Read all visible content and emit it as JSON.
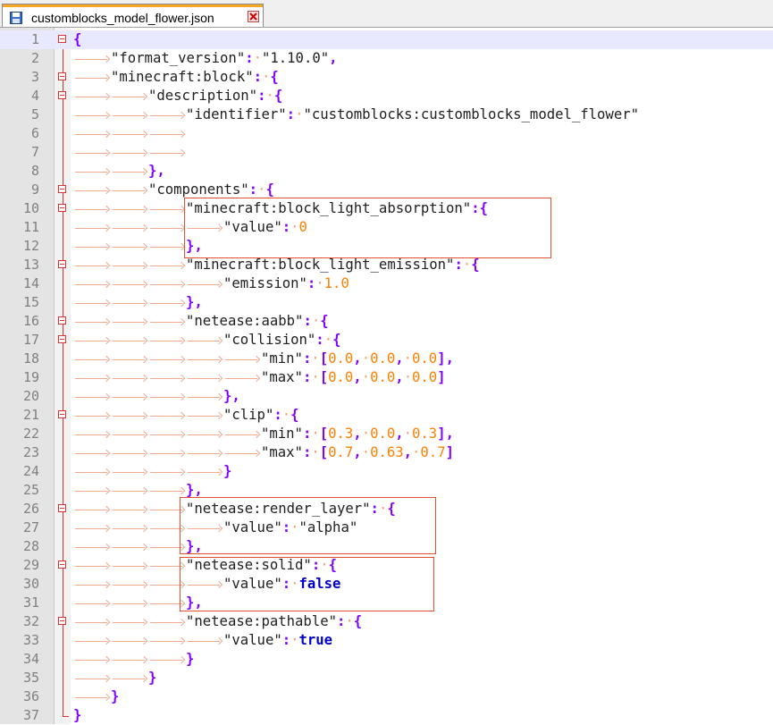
{
  "tab": {
    "title": "customblocks_model_flower.json",
    "save_icon": "floppy-disk-icon",
    "close_icon": "close-icon"
  },
  "colors": {
    "operator": "#8000ff",
    "number": "#ff8000",
    "keyword": "#0000cc",
    "fold_marker": "#e03030",
    "annotation_box": "#e05030"
  },
  "lines": [
    {
      "n": "1",
      "i": 0,
      "f": "open",
      "t": [
        [
          "op",
          "{"
        ]
      ]
    },
    {
      "n": "2",
      "i": 1,
      "f": "",
      "t": [
        [
          "str",
          "\"format_version\""
        ],
        [
          "op",
          ":"
        ],
        [
          "sp",
          "·"
        ],
        [
          "str",
          "\"1.10.0\""
        ],
        [
          "op",
          ","
        ]
      ]
    },
    {
      "n": "3",
      "i": 1,
      "f": "open",
      "t": [
        [
          "str",
          "\"minecraft:block\""
        ],
        [
          "op",
          ":"
        ],
        [
          "sp",
          "·"
        ],
        [
          "op",
          "{"
        ]
      ]
    },
    {
      "n": "4",
      "i": 2,
      "f": "open",
      "t": [
        [
          "str",
          "\"description\""
        ],
        [
          "op",
          ":"
        ],
        [
          "sp",
          "·"
        ],
        [
          "op",
          "{"
        ]
      ]
    },
    {
      "n": "5",
      "i": 3,
      "f": "",
      "t": [
        [
          "str",
          "\"identifier\""
        ],
        [
          "op",
          ":"
        ],
        [
          "sp",
          "·"
        ],
        [
          "str",
          "\"customblocks:customblocks_model_flower\""
        ]
      ]
    },
    {
      "n": "6",
      "i": 3,
      "f": "",
      "t": []
    },
    {
      "n": "7",
      "i": 3,
      "f": "",
      "t": []
    },
    {
      "n": "8",
      "i": 2,
      "f": "",
      "t": [
        [
          "op",
          "}"
        ],
        [
          "op",
          ","
        ]
      ]
    },
    {
      "n": "9",
      "i": 2,
      "f": "open",
      "t": [
        [
          "str",
          "\"components\""
        ],
        [
          "op",
          ":"
        ],
        [
          "sp",
          "·"
        ],
        [
          "op",
          "{"
        ]
      ]
    },
    {
      "n": "10",
      "i": 3,
      "f": "open",
      "t": [
        [
          "str",
          "\"minecraft:block_light_absorption\""
        ],
        [
          "op",
          ":"
        ],
        [
          "op",
          "{"
        ]
      ]
    },
    {
      "n": "11",
      "i": 4,
      "f": "",
      "t": [
        [
          "str",
          "\"value\""
        ],
        [
          "op",
          ":"
        ],
        [
          "sp",
          "·"
        ],
        [
          "num",
          "0"
        ]
      ]
    },
    {
      "n": "12",
      "i": 3,
      "f": "",
      "t": [
        [
          "op",
          "}"
        ],
        [
          "op",
          ","
        ]
      ]
    },
    {
      "n": "13",
      "i": 3,
      "f": "open",
      "t": [
        [
          "str",
          "\"minecraft:block_light_emission\""
        ],
        [
          "op",
          ":"
        ],
        [
          "sp",
          "·"
        ],
        [
          "op",
          "{"
        ]
      ]
    },
    {
      "n": "14",
      "i": 4,
      "f": "",
      "t": [
        [
          "str",
          "\"emission\""
        ],
        [
          "op",
          ":"
        ],
        [
          "sp",
          "·"
        ],
        [
          "num",
          "1.0"
        ]
      ]
    },
    {
      "n": "15",
      "i": 3,
      "f": "",
      "t": [
        [
          "op",
          "}"
        ],
        [
          "op",
          ","
        ]
      ]
    },
    {
      "n": "16",
      "i": 3,
      "f": "open",
      "t": [
        [
          "str",
          "\"netease:aabb\""
        ],
        [
          "op",
          ":"
        ],
        [
          "sp",
          "·"
        ],
        [
          "op",
          "{"
        ]
      ]
    },
    {
      "n": "17",
      "i": 4,
      "f": "open",
      "t": [
        [
          "str",
          "\"collision\""
        ],
        [
          "op",
          ":"
        ],
        [
          "sp",
          "·"
        ],
        [
          "op",
          "{"
        ]
      ]
    },
    {
      "n": "18",
      "i": 5,
      "f": "",
      "t": [
        [
          "str",
          "\"min\""
        ],
        [
          "op",
          ":"
        ],
        [
          "sp",
          "·"
        ],
        [
          "op",
          "["
        ],
        [
          "num",
          "0.0"
        ],
        [
          "op",
          ","
        ],
        [
          "sp",
          "·"
        ],
        [
          "num",
          "0.0"
        ],
        [
          "op",
          ","
        ],
        [
          "sp",
          "·"
        ],
        [
          "num",
          "0.0"
        ],
        [
          "op",
          "]"
        ],
        [
          "op",
          ","
        ]
      ]
    },
    {
      "n": "19",
      "i": 5,
      "f": "",
      "t": [
        [
          "str",
          "\"max\""
        ],
        [
          "op",
          ":"
        ],
        [
          "sp",
          "·"
        ],
        [
          "op",
          "["
        ],
        [
          "num",
          "0.0"
        ],
        [
          "op",
          ","
        ],
        [
          "sp",
          "·"
        ],
        [
          "num",
          "0.0"
        ],
        [
          "op",
          ","
        ],
        [
          "sp",
          "·"
        ],
        [
          "num",
          "0.0"
        ],
        [
          "op",
          "]"
        ]
      ]
    },
    {
      "n": "20",
      "i": 4,
      "f": "",
      "t": [
        [
          "op",
          "}"
        ],
        [
          "op",
          ","
        ]
      ]
    },
    {
      "n": "21",
      "i": 4,
      "f": "open",
      "t": [
        [
          "str",
          "\"clip\""
        ],
        [
          "op",
          ":"
        ],
        [
          "sp",
          "·"
        ],
        [
          "op",
          "{"
        ]
      ]
    },
    {
      "n": "22",
      "i": 5,
      "f": "",
      "t": [
        [
          "str",
          "\"min\""
        ],
        [
          "op",
          ":"
        ],
        [
          "sp",
          "·"
        ],
        [
          "op",
          "["
        ],
        [
          "num",
          "0.3"
        ],
        [
          "op",
          ","
        ],
        [
          "sp",
          "·"
        ],
        [
          "num",
          "0.0"
        ],
        [
          "op",
          ","
        ],
        [
          "sp",
          "·"
        ],
        [
          "num",
          "0.3"
        ],
        [
          "op",
          "]"
        ],
        [
          "op",
          ","
        ]
      ]
    },
    {
      "n": "23",
      "i": 5,
      "f": "",
      "t": [
        [
          "str",
          "\"max\""
        ],
        [
          "op",
          ":"
        ],
        [
          "sp",
          "·"
        ],
        [
          "op",
          "["
        ],
        [
          "num",
          "0.7"
        ],
        [
          "op",
          ","
        ],
        [
          "sp",
          "·"
        ],
        [
          "num",
          "0.63"
        ],
        [
          "op",
          ","
        ],
        [
          "sp",
          "·"
        ],
        [
          "num",
          "0.7"
        ],
        [
          "op",
          "]"
        ]
      ]
    },
    {
      "n": "24",
      "i": 4,
      "f": "",
      "t": [
        [
          "op",
          "}"
        ]
      ]
    },
    {
      "n": "25",
      "i": 3,
      "f": "",
      "t": [
        [
          "op",
          "}"
        ],
        [
          "op",
          ","
        ]
      ]
    },
    {
      "n": "26",
      "i": 3,
      "f": "open",
      "t": [
        [
          "str",
          "\"netease:render_layer\""
        ],
        [
          "op",
          ":"
        ],
        [
          "sp",
          "·"
        ],
        [
          "op",
          "{"
        ]
      ]
    },
    {
      "n": "27",
      "i": 4,
      "f": "",
      "t": [
        [
          "str",
          "\"value\""
        ],
        [
          "op",
          ":"
        ],
        [
          "sp",
          "·"
        ],
        [
          "str",
          "\"alpha\""
        ]
      ]
    },
    {
      "n": "28",
      "i": 3,
      "f": "",
      "t": [
        [
          "op",
          "}"
        ],
        [
          "op",
          ","
        ]
      ]
    },
    {
      "n": "29",
      "i": 3,
      "f": "open",
      "t": [
        [
          "str",
          "\"netease:solid\""
        ],
        [
          "op",
          ":"
        ],
        [
          "sp",
          "·"
        ],
        [
          "op",
          "{"
        ]
      ]
    },
    {
      "n": "30",
      "i": 4,
      "f": "",
      "t": [
        [
          "str",
          "\"value\""
        ],
        [
          "op",
          ":"
        ],
        [
          "sp",
          "·"
        ],
        [
          "kw",
          "false"
        ]
      ]
    },
    {
      "n": "31",
      "i": 3,
      "f": "",
      "t": [
        [
          "op",
          "}"
        ],
        [
          "op",
          ","
        ]
      ]
    },
    {
      "n": "32",
      "i": 3,
      "f": "open",
      "t": [
        [
          "str",
          "\"netease:pathable\""
        ],
        [
          "op",
          ":"
        ],
        [
          "sp",
          "·"
        ],
        [
          "op",
          "{"
        ]
      ]
    },
    {
      "n": "33",
      "i": 4,
      "f": "",
      "t": [
        [
          "str",
          "\"value\""
        ],
        [
          "op",
          ":"
        ],
        [
          "sp",
          "·"
        ],
        [
          "kw",
          "true"
        ]
      ]
    },
    {
      "n": "34",
      "i": 3,
      "f": "",
      "t": [
        [
          "op",
          "}"
        ]
      ]
    },
    {
      "n": "35",
      "i": 2,
      "f": "",
      "t": [
        [
          "op",
          "}"
        ]
      ]
    },
    {
      "n": "36",
      "i": 1,
      "f": "",
      "t": [
        [
          "op",
          "}"
        ]
      ]
    },
    {
      "n": "37",
      "i": 0,
      "f": "end",
      "t": [
        [
          "op",
          "}"
        ]
      ]
    }
  ]
}
